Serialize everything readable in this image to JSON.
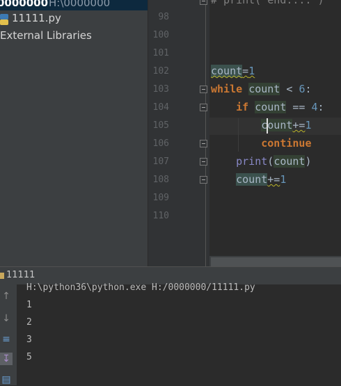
{
  "project": {
    "root_name": "0000000",
    "root_path": "H:\\0000000",
    "file_name": "11111.py",
    "external_libraries": "External Libraries"
  },
  "editor": {
    "line_numbers": [
      "98",
      "100",
      "101",
      "102",
      "103",
      "104",
      "105",
      "106",
      "107",
      "108",
      "109",
      "110"
    ],
    "top_comment": "# print(\"end....\")",
    "code": {
      "l102_var": "count",
      "l102_op": "=",
      "l102_num": "1",
      "l103_kw": "while",
      "l103_var": "count",
      "l103_op": " < ",
      "l103_num": "6",
      "l103_colon": ":",
      "l104_kw": "if",
      "l104_var": "count",
      "l104_op": " == ",
      "l104_num": "4",
      "l104_colon": ":",
      "l105_var": "count",
      "l105_op": "+=",
      "l105_num": "1",
      "l106_kw": "continue",
      "l107_fn": "print",
      "l107_open": "(",
      "l107_var": "count",
      "l107_close": ")",
      "l108_var": "count",
      "l108_op": "+=",
      "l108_num": "1"
    }
  },
  "run": {
    "title": "11111",
    "command": "H:\\python36\\python.exe H:/0000000/11111.py",
    "output": [
      "1",
      "2",
      "3",
      "5"
    ]
  },
  "colors": {
    "keyword": "#cc7832",
    "number": "#6897bb",
    "text": "#a9b7c6",
    "background": "#2b2b2b",
    "panel": "#3c3f41"
  }
}
